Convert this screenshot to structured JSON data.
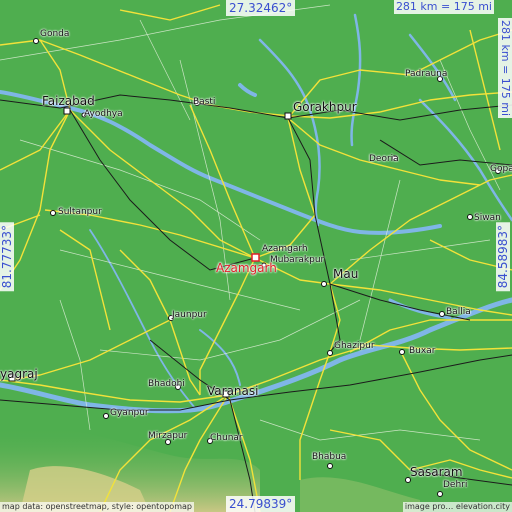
{
  "map": {
    "selected_city": "Azamgarh",
    "coords": {
      "top_lat": "27.32462°",
      "bottom_lat": "24.79839°",
      "left_lon": "81.77733°",
      "right_lon": "84.58983°"
    },
    "scale": {
      "horizontal": "281 km = 175 mi",
      "vertical": "281 km = 175 mi"
    },
    "cities": [
      {
        "key": "gonda",
        "label": "Gonda"
      },
      {
        "key": "faizabad",
        "label": "Faizabad"
      },
      {
        "key": "ayodhya",
        "label": "Ayodhya"
      },
      {
        "key": "basti",
        "label": "Basti"
      },
      {
        "key": "gorakhpur",
        "label": "Gorakhpur"
      },
      {
        "key": "padrauna",
        "label": "Padrauna"
      },
      {
        "key": "deoria",
        "label": "Deoria"
      },
      {
        "key": "gopa",
        "label": "Gopa"
      },
      {
        "key": "siwan",
        "label": "Siwan"
      },
      {
        "key": "sultanpur",
        "label": "Sultanpur"
      },
      {
        "key": "azamgarh_small",
        "label": "Azamgarh"
      },
      {
        "key": "mubarakpur",
        "label": "Mubarakpur"
      },
      {
        "key": "mau",
        "label": "Mau"
      },
      {
        "key": "ballia",
        "label": "Ballia"
      },
      {
        "key": "jaunpur",
        "label": "Jaunpur"
      },
      {
        "key": "ghazipur",
        "label": "Ghazipur"
      },
      {
        "key": "buxar",
        "label": "Buxar"
      },
      {
        "key": "prayagraj",
        "label": "yagraj"
      },
      {
        "key": "bhadohi",
        "label": "Bhadohi"
      },
      {
        "key": "varanasi",
        "label": "Varanasi"
      },
      {
        "key": "gyanpur",
        "label": "Gyanpur"
      },
      {
        "key": "mirzapur",
        "label": "Mirzapur"
      },
      {
        "key": "chunar",
        "label": "Chunar"
      },
      {
        "key": "bhabua",
        "label": "Bhabua"
      },
      {
        "key": "sasaram",
        "label": "Sasaram"
      },
      {
        "key": "dehri",
        "label": "Dehri"
      }
    ],
    "attribution_left": "map data: openstreetmap, style: opentopomap",
    "attribution_right": "image pro… elevation.city",
    "colors": {
      "land": "#4fae4f",
      "roads": "#f2e23a",
      "rivers": "#7fb6e6",
      "railway": "#1b1b1b",
      "highlight": "#e0202a",
      "coord_text": "#3a4fd0"
    }
  }
}
